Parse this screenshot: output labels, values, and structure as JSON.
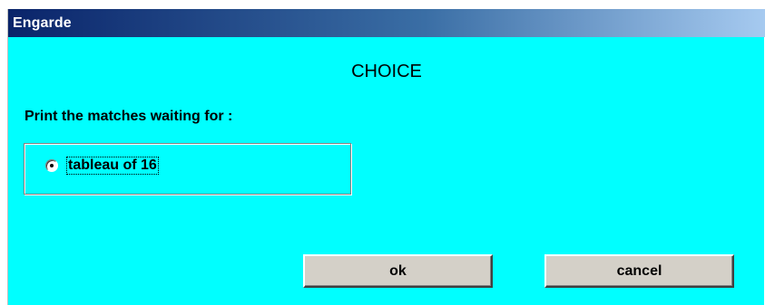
{
  "window": {
    "title": "Engarde"
  },
  "dialog": {
    "heading": "CHOICE",
    "prompt": "Print the matches waiting for :",
    "options": [
      {
        "label": "tableau of 16",
        "selected": true
      }
    ],
    "ok_label": "ok",
    "cancel_label": "cancel"
  },
  "colors": {
    "background": "#00ffff",
    "titlebar_start": "#0a246a",
    "titlebar_end": "#a6caf0",
    "button_face": "#d4d0c8"
  }
}
